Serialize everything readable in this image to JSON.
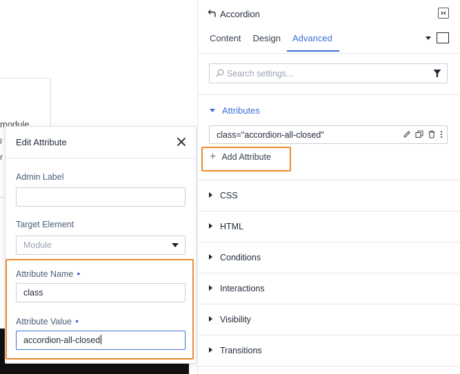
{
  "canvas": {
    "text_module": "module",
    "text_i": "i",
    "text_r": "r"
  },
  "modal": {
    "title": "Edit Attribute",
    "admin_label": {
      "label": "Admin Label",
      "value": ""
    },
    "target_element": {
      "label": "Target Element",
      "selected": "Module"
    },
    "attribute_name": {
      "label": "Attribute Name",
      "value": "class"
    },
    "attribute_value": {
      "label": "Attribute Value",
      "value": "accordion-all-closed"
    },
    "required_marker": "•"
  },
  "panel": {
    "module_title": "Accordion",
    "tabs": [
      {
        "label": "Content",
        "active": false
      },
      {
        "label": "Design",
        "active": false
      },
      {
        "label": "Advanced",
        "active": true
      }
    ],
    "search": {
      "placeholder": "Search settings..."
    },
    "attributes": {
      "heading": "Attributes",
      "items": [
        {
          "text": "class=\"accordion-all-closed\""
        }
      ],
      "add_label": "Add Attribute"
    },
    "groups": [
      {
        "label": "CSS"
      },
      {
        "label": "HTML"
      },
      {
        "label": "Conditions"
      },
      {
        "label": "Interactions"
      },
      {
        "label": "Visibility"
      },
      {
        "label": "Transitions"
      }
    ]
  },
  "colors": {
    "accent": "#3b6fd4",
    "highlight": "#ef8a2b",
    "border": "#c9ced6"
  }
}
